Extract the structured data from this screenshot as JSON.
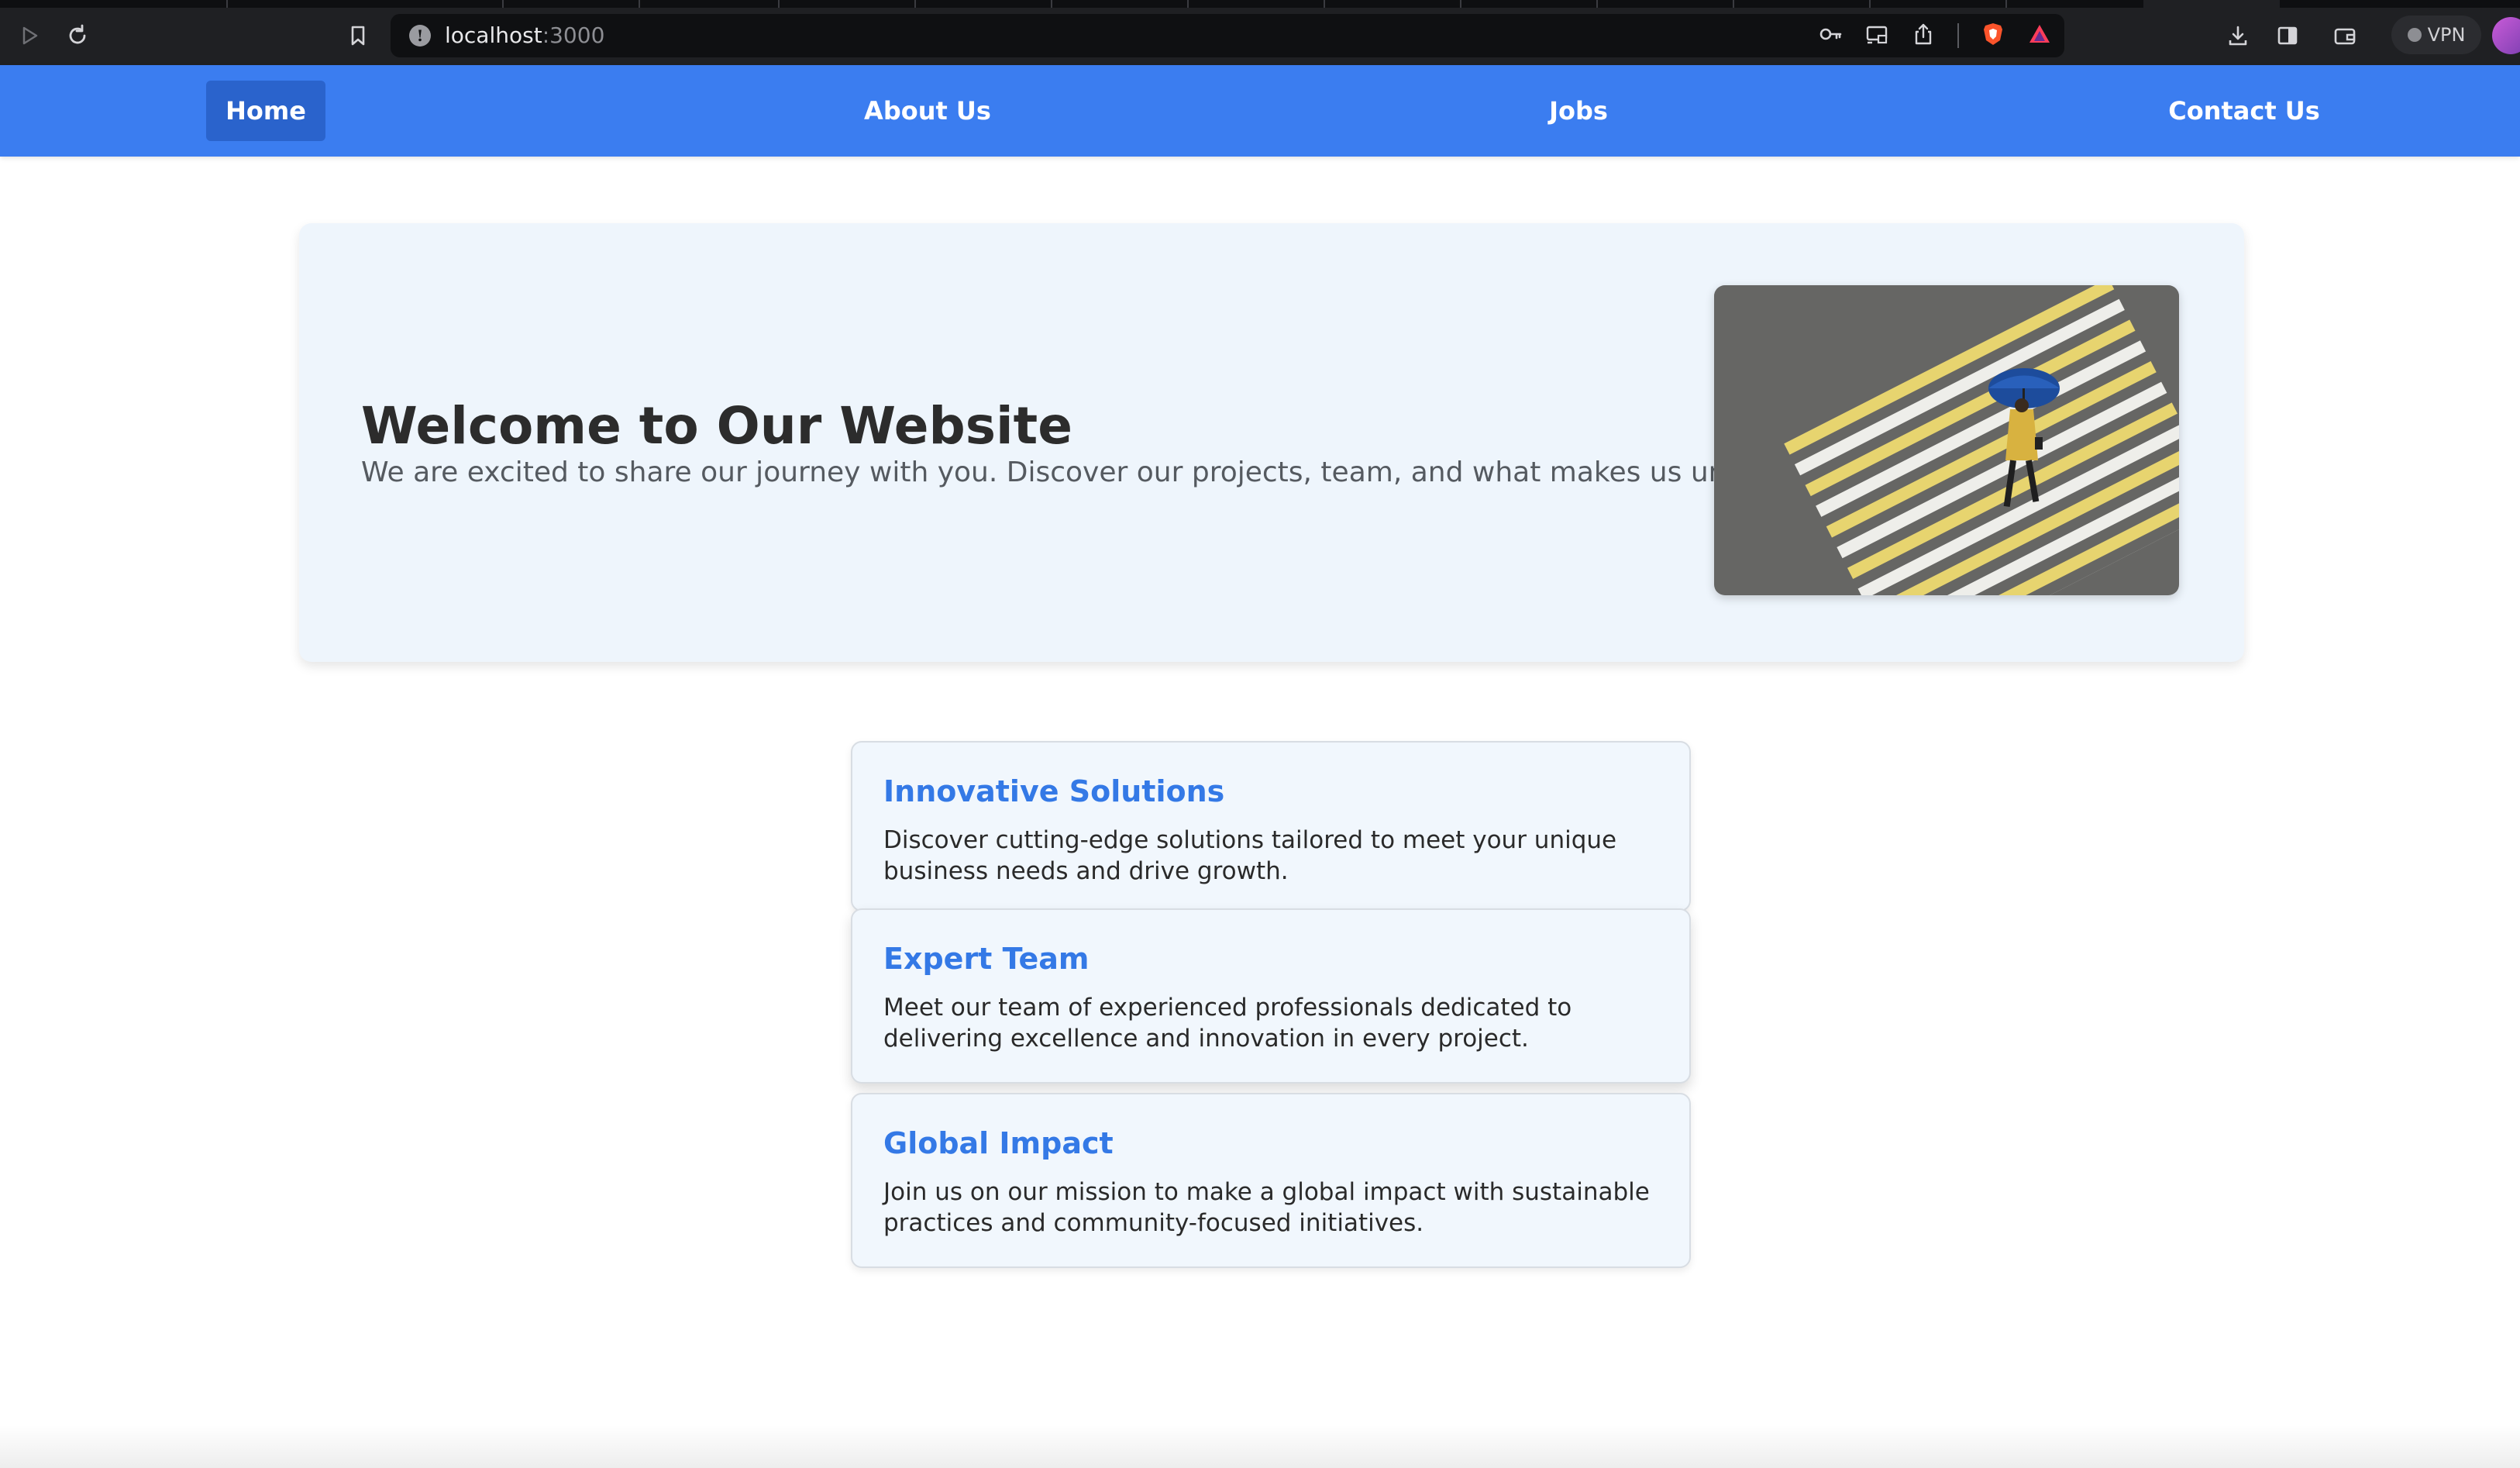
{
  "browser": {
    "url_host": "localhost",
    "url_port": ":3000",
    "vpn_label": "VPN",
    "icons": [
      "play-icon",
      "reload-icon",
      "bookmark-icon",
      "key-icon",
      "cast-icon",
      "share-icon",
      "brave-shield-icon",
      "brave-rewards-icon",
      "download-icon",
      "sidebar-icon",
      "wallet-icon"
    ]
  },
  "nav": {
    "items": [
      {
        "label": "Home",
        "active": true
      },
      {
        "label": "About Us",
        "active": false
      },
      {
        "label": "Jobs",
        "active": false
      },
      {
        "label": "Contact Us",
        "active": false
      }
    ]
  },
  "hero": {
    "title": "Welcome to Our Website",
    "subtitle": "We are excited to share our journey with you. Discover our projects, team, and what makes us unique."
  },
  "features": [
    {
      "title": "Innovative Solutions",
      "description": "Discover cutting-edge solutions tailored to meet your unique business needs and drive growth."
    },
    {
      "title": "Expert Team",
      "description": "Meet our team of experienced professionals dedicated to delivering excellence and innovation in every project."
    },
    {
      "title": "Global Impact",
      "description": "Join us on our mission to make a global impact with sustainable practices and community-focused initiatives."
    }
  ],
  "colors": {
    "nav_bg": "#3b7df0",
    "nav_active": "#2a63cc",
    "card_title": "#3479e6",
    "hero_bg": "#eef5fc"
  }
}
